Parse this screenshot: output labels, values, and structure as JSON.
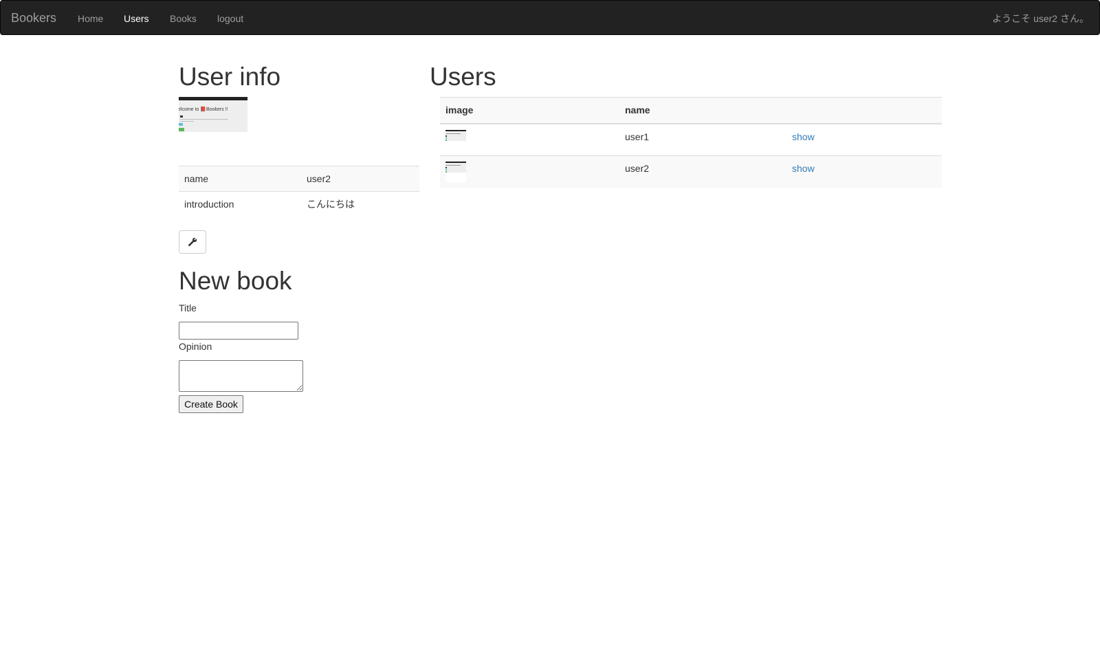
{
  "navbar": {
    "brand": "Bookers",
    "links": [
      {
        "label": "Home",
        "active": false
      },
      {
        "label": "Users",
        "active": true
      },
      {
        "label": "Books",
        "active": false
      },
      {
        "label": "logout",
        "active": false
      }
    ],
    "welcome": "ようこそ user2 さん。"
  },
  "user_info": {
    "heading": "User info",
    "image_caption": "elcome to 📕Bookers !!",
    "rows": [
      {
        "key": "name",
        "value": "user2"
      },
      {
        "key": "introduction",
        "value": "こんにちは"
      }
    ],
    "edit_icon": "wrench-icon"
  },
  "new_book": {
    "heading": "New book",
    "title_label": "Title",
    "title_value": "",
    "opinion_label": "Opinion",
    "opinion_value": "",
    "submit_label": "Create Book"
  },
  "users": {
    "heading": "Users",
    "columns": [
      "image",
      "name",
      ""
    ],
    "rows": [
      {
        "name": "user1",
        "link": "show"
      },
      {
        "name": "user2",
        "link": "show"
      }
    ]
  },
  "colors": {
    "navbar_bg": "#222222",
    "link": "#337ab7",
    "nav_text": "#9d9d9d"
  }
}
